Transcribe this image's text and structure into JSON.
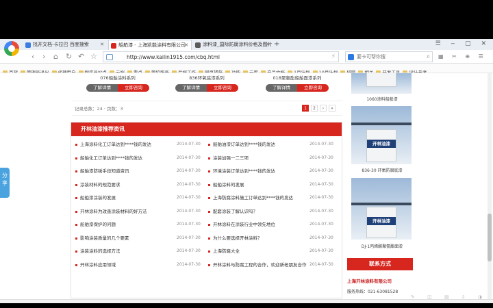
{
  "tabs": [
    {
      "label": "找开文档-卡拉巴 百度搜索",
      "fav_color": "#3b7de0",
      "active": false
    },
    {
      "label": "船舶漆 - 上海凯能涂料有限公司",
      "fav_color": "#d7261e",
      "active": true
    },
    {
      "label": "涂料漆_国际防腐涂料价格及图片",
      "fav_color": "#5a5a5a",
      "active": false
    }
  ],
  "nav": {
    "url": "http://www.kailin1915.com/cbq.html",
    "search_placeholder": "要卡可帮你搜"
  },
  "bookmarks": [
    "百货",
    "管理员退出",
    "代理用户",
    "程序员站点",
    "云端",
    "看点",
    "管控服务",
    "后端工作",
    "网页捕获",
    "功能",
    "云库",
    "产品文档",
    "1月计划",
    "10月计划",
    "排障",
    "相关",
    "开发工具",
    "设计参考"
  ],
  "products": [
    {
      "name": "076船舶涂料系列",
      "detail": "了解详情",
      "consult": "立即咨询"
    },
    {
      "name": "836环氧底漆系列",
      "detail": "了解详情",
      "consult": "立即咨询"
    },
    {
      "name": "018聚氨酯船舶面漆系列",
      "detail": "了解详情",
      "consult": "立即咨询"
    }
  ],
  "pagination": {
    "records": "记录总数：24 · 页数：3",
    "pages": [
      "1",
      "2",
      "›",
      "»"
    ]
  },
  "share_label": "分享",
  "news": {
    "title": "开林油漆推荐资讯",
    "left": [
      {
        "title": "上海涂料化工订单达到****钱的发达",
        "date": "2014-07-30"
      },
      {
        "title": "船舶化工订单达到****钱的发达",
        "date": "2014-07-30"
      },
      {
        "title": "船舶漆防锈手段知道资讯",
        "date": "2014-07-30"
      },
      {
        "title": "涂装材料的规范要求",
        "date": "2014-07-30"
      },
      {
        "title": "船舶漆涂装的发展",
        "date": "2014-07-30"
      },
      {
        "title": "开林涂料为改善涂装材料的好方法",
        "date": "2014-07-30"
      },
      {
        "title": "船舶漆保护的问题",
        "date": "2014-07-30"
      },
      {
        "title": "影响涂装质量的几个要素",
        "date": "2014-07-30"
      },
      {
        "title": "涂装涂料的选择方法",
        "date": "2014-07-30"
      },
      {
        "title": "开林涂料应用领域",
        "date": "2014-07-30"
      }
    ],
    "right": [
      {
        "title": "船舶油漆订单达到****钱的发达",
        "date": "2014-07-30"
      },
      {
        "title": "涂装加强一二三项",
        "date": "2014-07-30"
      },
      {
        "title": "环境涂装订单达到****钱的发达",
        "date": "2014-07-30"
      },
      {
        "title": "船舶涂料的发展",
        "date": "2014-07-30"
      },
      {
        "title": "上海防腐涂料施工订单达到****钱的发达",
        "date": "2014-07-30"
      },
      {
        "title": "配套涂装了解认识吗？",
        "date": "2014-07-30"
      },
      {
        "title": "开林涂料在涂装行业中领先地位",
        "date": "2014-07-30"
      },
      {
        "title": "为什么要选择开林涂料？",
        "date": "2014-07-30"
      },
      {
        "title": "上海防腐大全",
        "date": "2014-07-30"
      },
      {
        "title": "开林涂料与防腐工程的合作，欢迎新老朋友合作",
        "date": "2014-07-30"
      }
    ]
  },
  "sidebar": {
    "captions": [
      "1060涂料船舶漆",
      "836-30 环氧防腐底漆",
      "DJ-1丙烯酸聚氨酯面漆"
    ],
    "bucket_brand": "开林油漆",
    "contact_title": "联系方式",
    "company": "上海开林涂料有限公司",
    "tel": "服务热线：021-63081528"
  }
}
